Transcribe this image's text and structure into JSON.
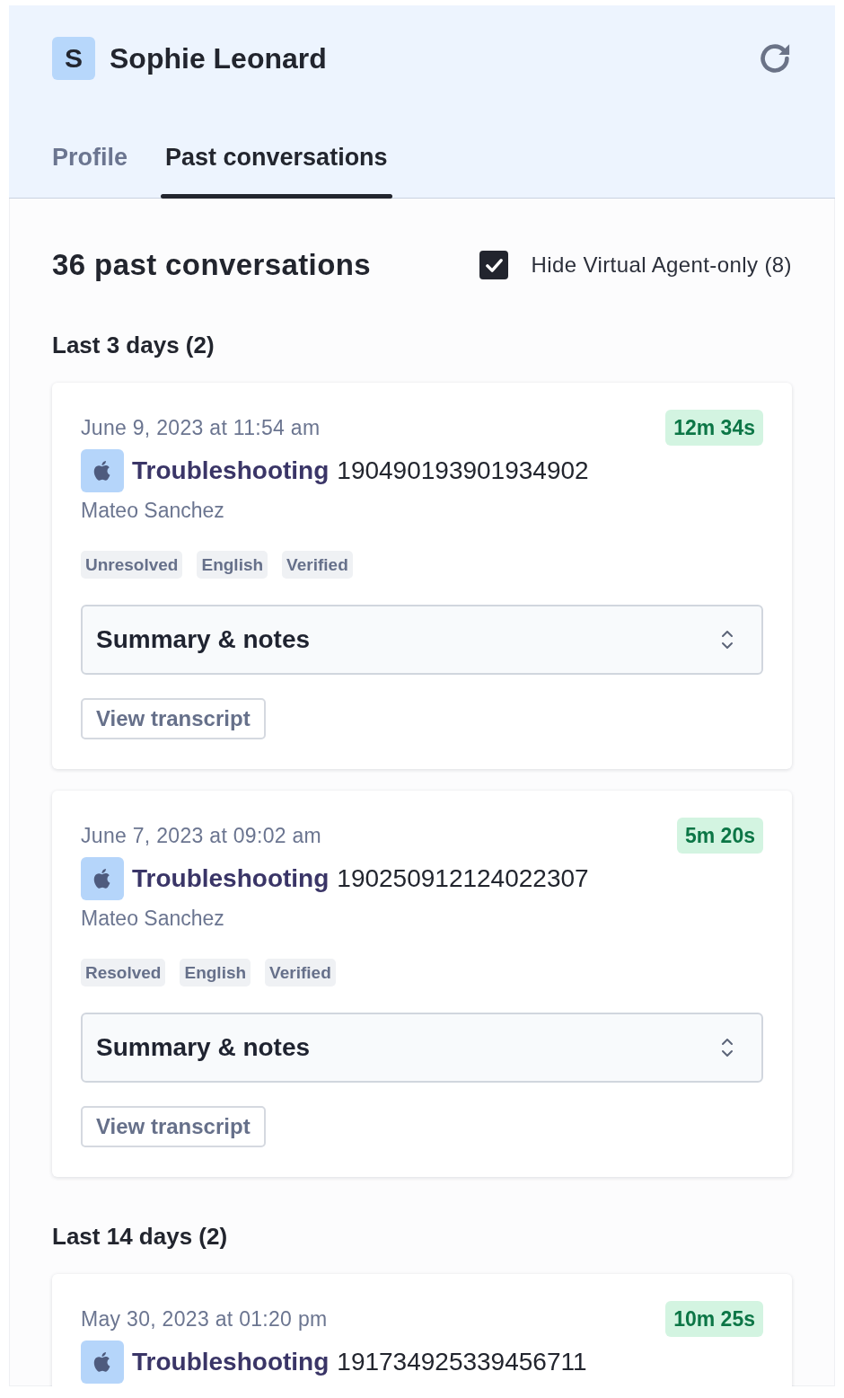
{
  "header": {
    "avatar_initial": "S",
    "name": "Sophie Leonard"
  },
  "tabs": [
    {
      "label": "Profile",
      "selected": false
    },
    {
      "label": "Past conversations",
      "selected": true
    }
  ],
  "overview": {
    "title": "36 past conversations",
    "filter": {
      "label": "Hide Virtual Agent-only (8)",
      "checked": true
    }
  },
  "groups": [
    {
      "heading": "Last 3 days (2)",
      "conversations": [
        {
          "date": "June 9, 2023 at 11:54 am",
          "duration": "12m 34s",
          "topic": "Troubleshooting",
          "id": "190490193901934902",
          "agent": "Mateo Sanchez",
          "tags": [
            "Unresolved",
            "English",
            "Verified"
          ],
          "summary_label": "Summary & notes",
          "action": "View transcript"
        },
        {
          "date": "June 7, 2023 at 09:02 am",
          "duration": "5m 20s",
          "topic": "Troubleshooting",
          "id": "190250912124022307",
          "agent": "Mateo Sanchez",
          "tags": [
            "Resolved",
            "English",
            "Verified"
          ],
          "summary_label": "Summary & notes",
          "action": "View transcript"
        }
      ]
    },
    {
      "heading": "Last 14 days (2)",
      "conversations": [
        {
          "date": "May 30, 2023 at 01:20 pm",
          "duration": "10m 25s",
          "topic": "Troubleshooting",
          "id": "191734925339456711"
        }
      ]
    }
  ]
}
